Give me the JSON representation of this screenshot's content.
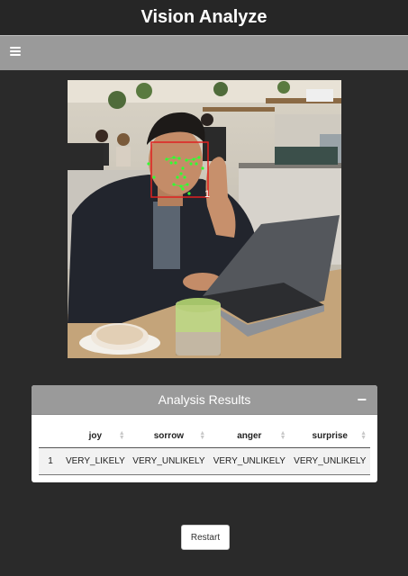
{
  "header": {
    "title": "Vision Analyze"
  },
  "toolbar": {
    "menu_icon": "hamburger-menu-icon"
  },
  "image": {
    "face_box_label": "1",
    "colors": {
      "face_box": "#e02020",
      "landmark": "#33ff33"
    }
  },
  "results": {
    "title": "Analysis Results",
    "collapse_label": "−",
    "columns": [
      "joy",
      "sorrow",
      "anger",
      "surprise"
    ],
    "rows": [
      {
        "index": "1",
        "joy": "VERY_LIKELY",
        "sorrow": "VERY_UNLIKELY",
        "anger": "VERY_UNLIKELY",
        "surprise": "VERY_UNLIKELY"
      }
    ]
  },
  "actions": {
    "restart_label": "Restart"
  }
}
